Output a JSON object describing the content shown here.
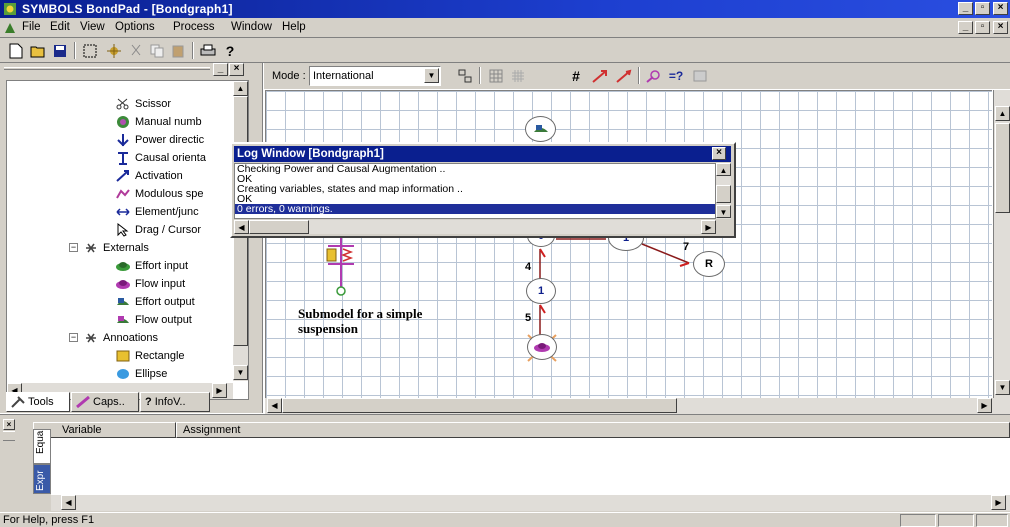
{
  "window": {
    "title": "SYMBOLS BondPad - [Bondgraph1]",
    "controls": [
      "_",
      "□",
      "×"
    ]
  },
  "menubar": {
    "items": [
      "File",
      "Edit",
      "View",
      "Options",
      "Process",
      "Window",
      "Help"
    ]
  },
  "toolbar": {
    "icons": [
      "new-icon",
      "open-icon",
      "save-icon",
      "select-icon",
      "component-icon",
      "cut-icon",
      "copy-icon",
      "paste-icon",
      "print-icon",
      "help-icon"
    ]
  },
  "mode_bar": {
    "label": "Mode :",
    "value": "International"
  },
  "tools_panel": {
    "tools_items": [
      {
        "label": "Scissor",
        "icon": "scissor-icon"
      },
      {
        "label": "Manual numb",
        "icon": "manual-number-icon"
      },
      {
        "label": "Power directic",
        "icon": "power-direction-icon"
      },
      {
        "label": "Causal orienta",
        "icon": "causal-orientation-icon"
      },
      {
        "label": "Activation",
        "icon": "activation-icon"
      },
      {
        "label": "Modulous spe",
        "icon": "modulus-icon"
      },
      {
        "label": "Element/junc",
        "icon": "element-junction-icon"
      },
      {
        "label": "Drag / Cursor",
        "icon": "cursor-icon"
      }
    ],
    "externals_label": "Externals",
    "externals_items": [
      {
        "label": "Effort input",
        "icon": "effort-input-icon"
      },
      {
        "label": "Flow input",
        "icon": "flow-input-icon"
      },
      {
        "label": "Effort output",
        "icon": "effort-output-icon"
      },
      {
        "label": "Flow output",
        "icon": "flow-output-icon"
      }
    ],
    "annotations_label": "Annoations",
    "annotations_items": [
      {
        "label": "Rectangle",
        "icon": "rectangle-icon"
      },
      {
        "label": "Ellipse",
        "icon": "ellipse-icon"
      }
    ],
    "tabs": [
      "Tools",
      "Caps..",
      "InfoV.."
    ]
  },
  "canvas": {
    "caption_line1": "Submodel for a simple",
    "caption_line2": "suspension",
    "node_0": "0",
    "node_1_top": "1",
    "node_1_mid": "1",
    "node_R": "R",
    "bond_7": "7",
    "bond_4": "4",
    "bond_5": "5"
  },
  "log_window": {
    "title": "Log Window [Bondgraph1]",
    "lines": [
      "Checking Power and Causal Augmentation ..",
      "OK",
      "Creating variables, states and map information ..",
      "OK",
      "0 errors, 0 warnings."
    ]
  },
  "bottom_panel": {
    "columns": [
      "Variable",
      "Assignment"
    ],
    "side_tabs": [
      "Equa",
      "Expr"
    ]
  },
  "statusbar": {
    "text": "For Help, press F1"
  }
}
